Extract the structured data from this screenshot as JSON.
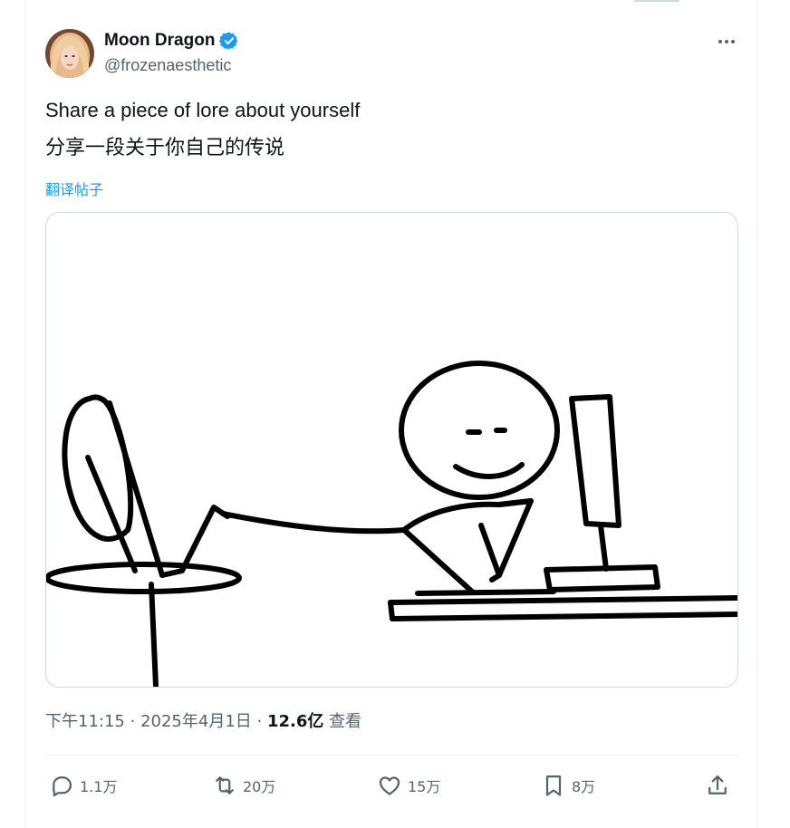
{
  "author": {
    "display_name": "Moon Dragon",
    "handle": "@frozenaesthetic",
    "verified": true
  },
  "tweet": {
    "text": "Share a piece of lore about yourself",
    "text_cn": "分享一段关于你自己的传说",
    "translate_label": "翻译帖子"
  },
  "meta": {
    "time": "下午11:15",
    "date": "2025年4月1日",
    "separator": "·",
    "views_count": "12.6亿",
    "views_label": "查看"
  },
  "actions": {
    "replies": "1.1万",
    "retweets": "20万",
    "likes": "15万",
    "bookmarks": "8万"
  },
  "colors": {
    "accent": "#1d9bf0",
    "text_primary": "#0f1419",
    "text_secondary": "#536471",
    "border": "#cfd9de"
  },
  "icons": [
    "verified-badge-icon",
    "more-icon",
    "reply-icon",
    "retweet-icon",
    "like-icon",
    "bookmark-icon",
    "share-icon"
  ]
}
